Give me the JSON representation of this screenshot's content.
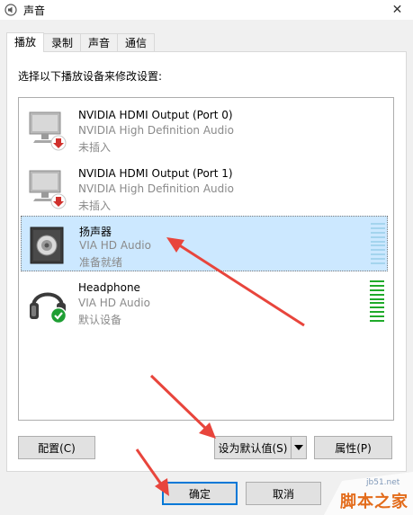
{
  "window": {
    "title": "声音",
    "app_icon": "speaker-app-icon",
    "close_label": "✕"
  },
  "tabs": [
    {
      "label": "播放",
      "active": true
    },
    {
      "label": "录制",
      "active": false
    },
    {
      "label": "声音",
      "active": false
    },
    {
      "label": "通信",
      "active": false
    }
  ],
  "instruction": "选择以下播放设备来修改设置:",
  "devices": [
    {
      "name": "NVIDIA HDMI Output (Port 0)",
      "driver": "NVIDIA High Definition Audio",
      "status": "未插入",
      "icon": "monitor-icon",
      "badge": "down-arrow-badge",
      "selected": false
    },
    {
      "name": "NVIDIA HDMI Output (Port 1)",
      "driver": "NVIDIA High Definition Audio",
      "status": "未插入",
      "icon": "monitor-icon",
      "badge": "down-arrow-badge",
      "selected": false
    },
    {
      "name": "扬声器",
      "driver": "VIA HD Audio",
      "status": "准备就绪",
      "icon": "speaker-icon",
      "badge": "",
      "selected": true,
      "level": 0
    },
    {
      "name": "Headphone",
      "driver": "VIA HD Audio",
      "status": "默认设备",
      "icon": "headphone-icon",
      "badge": "checkmark-badge",
      "selected": false,
      "level": 1
    }
  ],
  "buttons": {
    "configure": "配置(C)",
    "set_default": "设为默认值(S)",
    "properties": "属性(P)",
    "ok": "确定",
    "cancel": "取消"
  },
  "watermark": {
    "url": "jb51.net",
    "name": "脚本之家"
  },
  "colors": {
    "selection": "#cce8ff",
    "arrow": "#e8453c",
    "level_active": "#1faa2a",
    "level_idle": "#a4d4ee",
    "focus_blue": "#0078d7"
  }
}
